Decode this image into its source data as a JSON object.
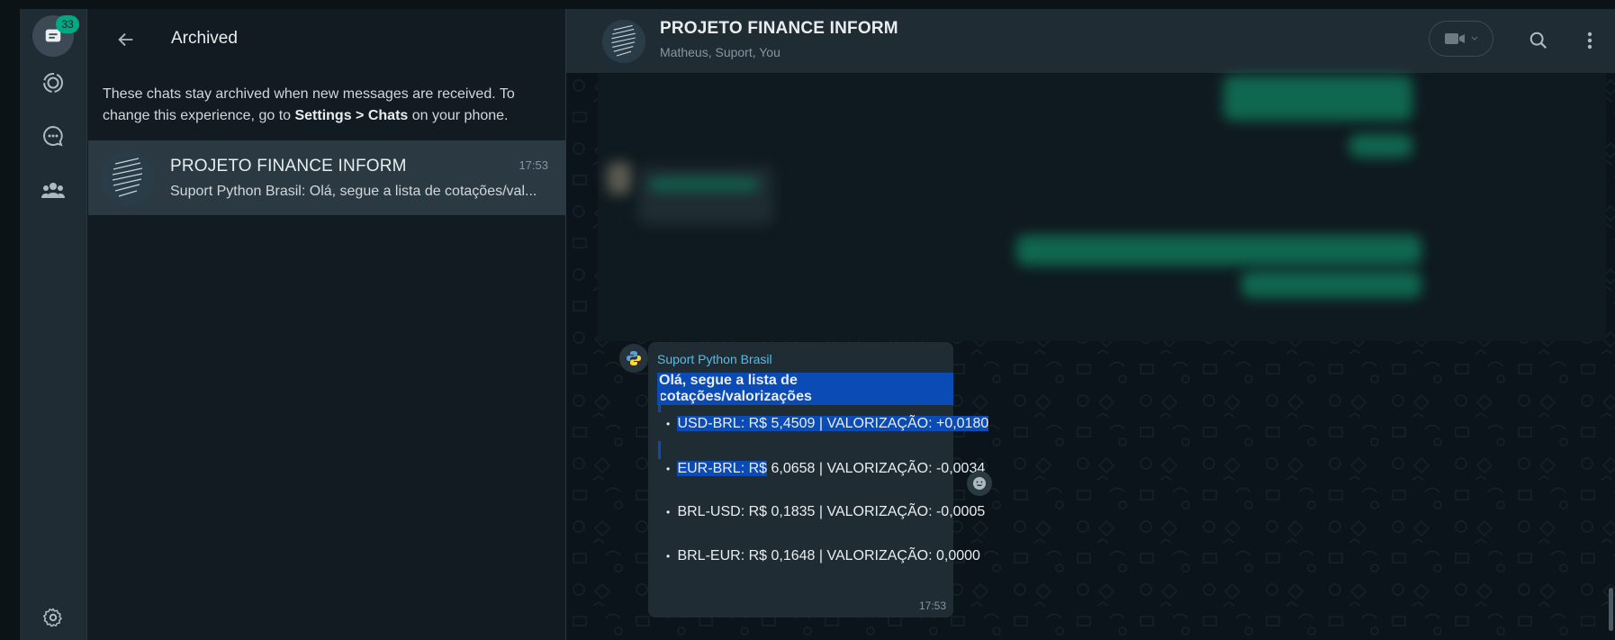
{
  "rail": {
    "archived_badge": "33",
    "icons": [
      "archive-chats-icon",
      "status-icon",
      "channels-icon",
      "communities-icon",
      "settings-icon"
    ]
  },
  "archived_panel": {
    "title": "Archived",
    "info_prefix": "These chats stay archived when new messages are received. To change this experience, go to ",
    "info_settings": "Settings",
    "info_sep": " > ",
    "info_chats": "Chats",
    "info_suffix": " on your phone.",
    "chat": {
      "name": "PROJETO FINANCE INFORM",
      "time": "17:53",
      "preview": "Suport Python Brasil: Olá, segue a lista de cotações/val..."
    }
  },
  "conversation": {
    "title": "PROJETO FINANCE INFORM",
    "participants": "Matheus, Suport, You",
    "message": {
      "sender": "Suport Python Brasil",
      "greeting": "Olá, segue a lista de cotações/valorizações",
      "lines": [
        "USD-BRL: R$ 5,4509 | VALORIZAÇÃO: +0,0180",
        "EUR-BRL: R$",
        " 6,0658 | VALORIZAÇÃO: -0,0034",
        "BRL-USD: R$ 0,1835 | VALORIZAÇÃO: -0,0005",
        "BRL-EUR: R$ 0,1648 | VALORIZAÇÃO: 0,0000"
      ],
      "bullet": "•",
      "time": "17:53"
    }
  },
  "colors": {
    "accent": "#00a884",
    "selection": "#0b4bb5",
    "sender": "#53bdeb",
    "panel": "#202c33",
    "background": "#111b21"
  }
}
